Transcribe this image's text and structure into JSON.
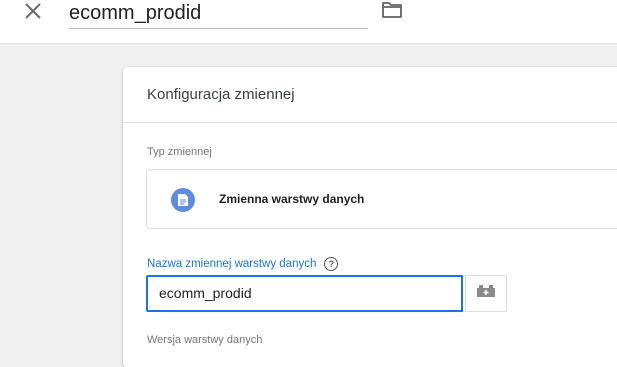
{
  "header": {
    "title": "ecomm_prodid",
    "close_icon": "close-icon",
    "folder_icon": "folder-icon"
  },
  "card": {
    "title": "Konfiguracja zmiennej",
    "type_section": {
      "label": "Typ zmiennej",
      "type_name": "Zmienna warstwy danych",
      "type_icon": "document-icon",
      "icon_color": "#5b8de0"
    },
    "name_section": {
      "label": "Nazwa zmiennej warstwy danych",
      "help_glyph": "?",
      "value": "ecomm_prodid",
      "accent_color": "#1a73e8",
      "picker_icon": "variable-picker-icon"
    },
    "version_section": {
      "label": "Wersja warstwy danych"
    }
  }
}
